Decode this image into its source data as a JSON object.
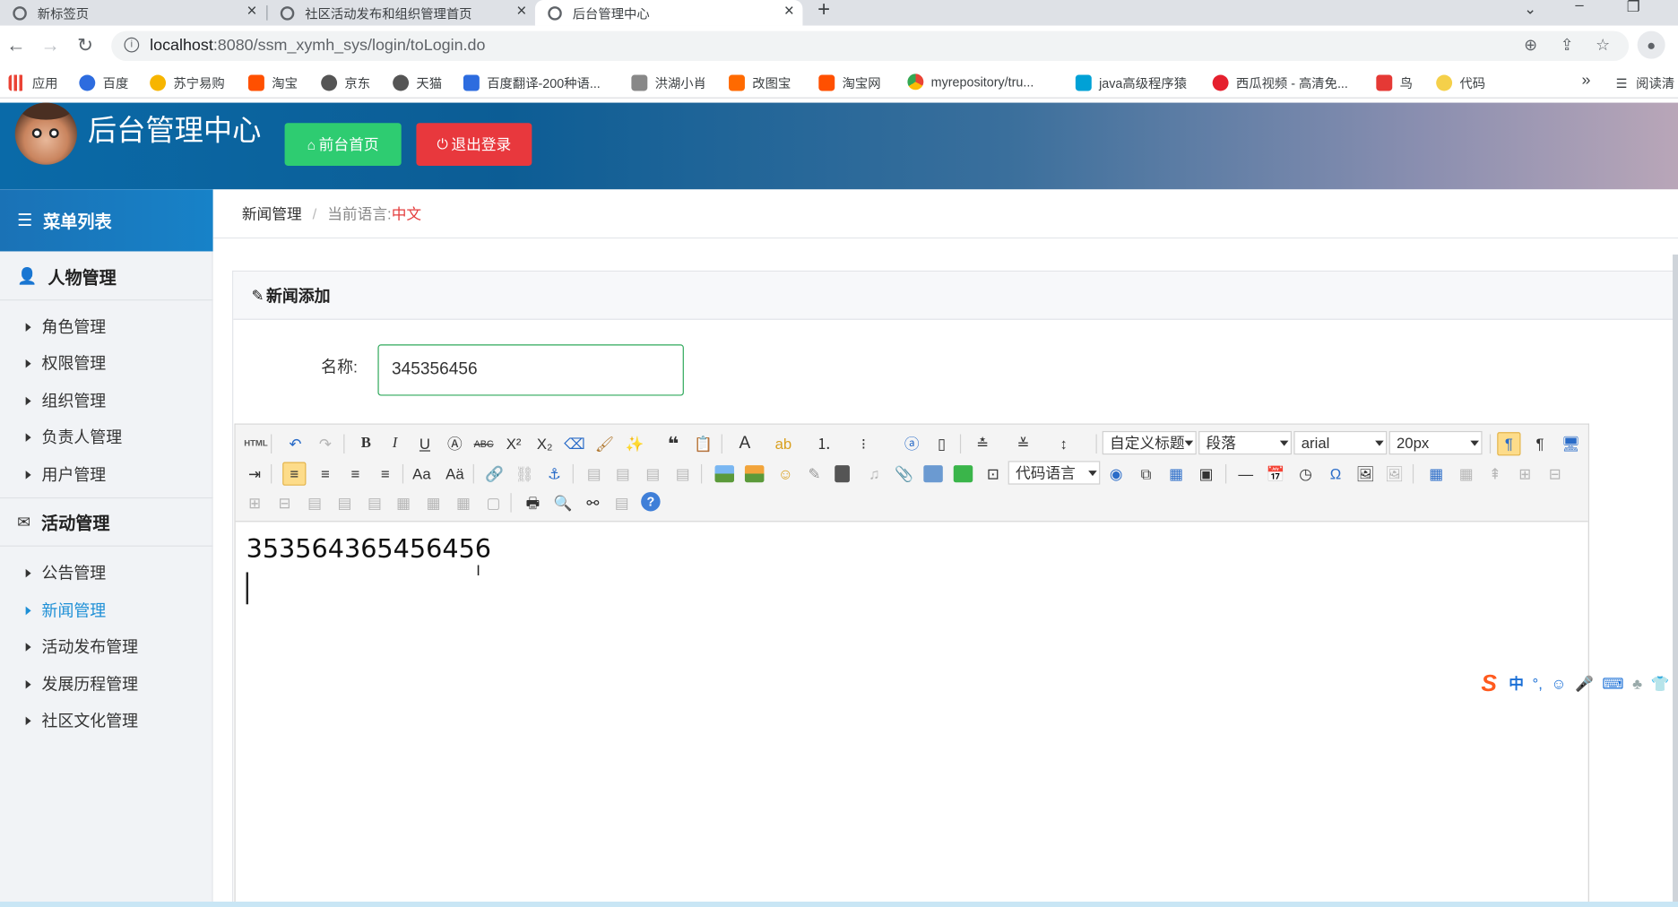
{
  "browser": {
    "tabs": [
      {
        "title": "新标签页"
      },
      {
        "title": "社区活动发布和组织管理首页"
      },
      {
        "title": "后台管理中心"
      }
    ],
    "url_host": "localhost",
    "url_rest": ":8080/ssm_xymh_sys/login/toLogin.do",
    "bookmarks": [
      {
        "label": "应用",
        "color": "#d9534f"
      },
      {
        "label": "百度",
        "color": "#2d6cdf"
      },
      {
        "label": "苏宁易购",
        "color": "#f7b500"
      },
      {
        "label": "淘宝",
        "color": "#ff5000"
      },
      {
        "label": "京东",
        "color": "#555555"
      },
      {
        "label": "天猫",
        "color": "#555555"
      },
      {
        "label": "百度翻译-200种语...",
        "color": "#2d6cdf"
      },
      {
        "label": "洪湖小肖",
        "color": "#888888"
      },
      {
        "label": "改图宝",
        "color": "#ff6a00"
      },
      {
        "label": "淘宝网",
        "color": "#ff5000"
      },
      {
        "label": "myrepository/tru...",
        "color": "#34a853"
      },
      {
        "label": "java高级程序猿",
        "color": "#00a1d6"
      },
      {
        "label": "西瓜视频 - 高清免...",
        "color": "#e5202e"
      },
      {
        "label": "鸟",
        "color": "#e53935"
      },
      {
        "label": "代码",
        "color": "#f5d04a"
      }
    ],
    "bookmarks_more": "»",
    "reading_list": "阅读清"
  },
  "header": {
    "title": "后台管理中心",
    "home_button": "前台首页",
    "logout_button": "退出登录"
  },
  "sidebar": {
    "heading": "菜单列表",
    "groups": [
      {
        "title": "人物管理",
        "items": [
          "角色管理",
          "权限管理",
          "组织管理",
          "负责人管理",
          "用户管理"
        ]
      },
      {
        "title": "活动管理",
        "items": [
          "公告管理",
          "新闻管理",
          "活动发布管理",
          "发展历程管理",
          "社区文化管理"
        ]
      }
    ],
    "active_item": "新闻管理"
  },
  "breadcrumb": {
    "section": "新闻管理",
    "separator": "/",
    "lang_label": "当前语言:",
    "lang_value": "中文"
  },
  "form": {
    "panel_title": "新闻添加",
    "name_label": "名称:",
    "name_value": "345356456",
    "editor": {
      "combos": {
        "title": "自定义标题",
        "paragraph": "段落",
        "font": "arial",
        "size": "20px",
        "code": "代码语言"
      },
      "content": "353564365456456"
    }
  },
  "ime": {
    "label": "中"
  }
}
